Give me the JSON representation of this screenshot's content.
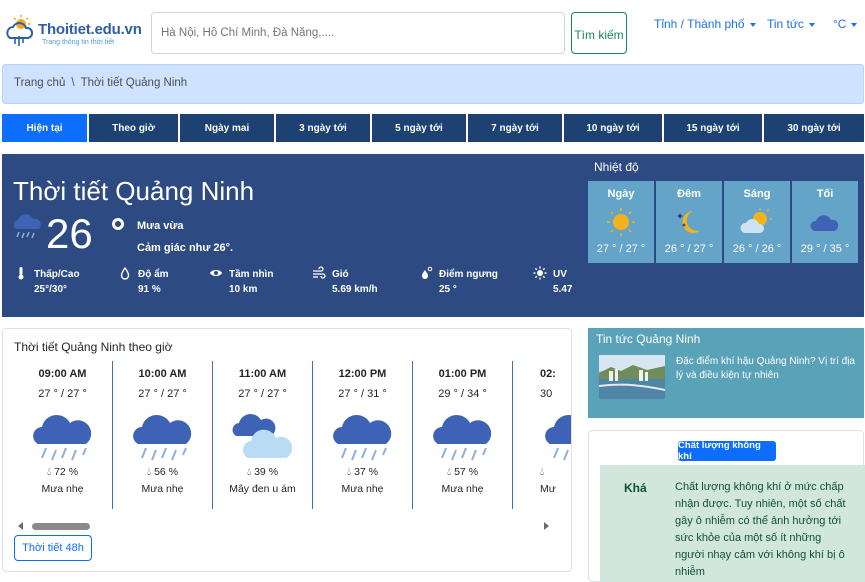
{
  "header": {
    "logo_text": "Thoitiet.edu.vn",
    "logo_sub": "Trang thông tin thời tiết",
    "search_placeholder": "Hà Nội, Hồ Chí Minh, Đà Nẵng,....",
    "search_button": "Tìm kiếm",
    "nav": [
      {
        "label": "Tỉnh / Thành phố"
      },
      {
        "label": "Tin tức"
      },
      {
        "label": "°C"
      }
    ]
  },
  "breadcrumb": {
    "home": "Trang chủ",
    "separator": "\\",
    "current": "Thời tiết Quảng Ninh"
  },
  "tabs": [
    {
      "label": "Hiện tại",
      "active": true
    },
    {
      "label": "Theo giờ"
    },
    {
      "label": "Ngày mai"
    },
    {
      "label": "3 ngày tới"
    },
    {
      "label": "5 ngày tới"
    },
    {
      "label": "7 ngày tới"
    },
    {
      "label": "10 ngày tới"
    },
    {
      "label": "15 ngày tới"
    },
    {
      "label": "30 ngày tới"
    }
  ],
  "current": {
    "title": "Thời tiết Quảng Ninh",
    "temperature": "26",
    "description": "Mưa vừa",
    "feels_like": "Cảm giác như 26°.",
    "icon": "rain-cloud-icon",
    "stats": [
      {
        "label": "Thấp/Cao",
        "value": "25°/30°",
        "icon": "thermometer-icon"
      },
      {
        "label": "Độ ẩm",
        "value": "91 %",
        "icon": "droplet-icon"
      },
      {
        "label": "Tầm nhìn",
        "value": "10 km",
        "icon": "eye-icon"
      },
      {
        "label": "Gió",
        "value": "5.69 km/h",
        "icon": "wind-icon"
      },
      {
        "label": "Điểm ngưng",
        "value": "25 °",
        "icon": "dewpoint-icon"
      },
      {
        "label": "UV",
        "value": "5.47",
        "icon": "sun-uv-icon"
      }
    ]
  },
  "temperature_panel": {
    "title": "Nhiệt độ",
    "cards": [
      {
        "name": "Ngày",
        "temp": "27 ° / 27 °",
        "icon": "sun-icon"
      },
      {
        "name": "Đêm",
        "temp": "26 ° / 27 °",
        "icon": "moon-stars-icon"
      },
      {
        "name": "Sáng",
        "temp": "26 ° / 26 °",
        "icon": "sun-cloud-icon"
      },
      {
        "name": "Tối",
        "temp": "29 ° / 35 °",
        "icon": "cloud-icon"
      }
    ]
  },
  "hourly": {
    "title": "Thời tiết Quảng Ninh theo giờ",
    "items": [
      {
        "time": "09:00 AM",
        "temp": "27 ° / 27 °",
        "humidity": "72 %",
        "desc": "Mưa nhẹ",
        "icon": "rain-cloud-icon"
      },
      {
        "time": "10:00 AM",
        "temp": "27 ° / 27 °",
        "humidity": "56 %",
        "desc": "Mưa nhẹ",
        "icon": "rain-cloud-icon"
      },
      {
        "time": "11:00 AM",
        "temp": "27 ° / 27 °",
        "humidity": "39 %",
        "desc": "Mây đen u ám",
        "icon": "overcast-cloud-icon"
      },
      {
        "time": "12:00 PM",
        "temp": "27 ° / 31 °",
        "humidity": "37 %",
        "desc": "Mưa nhẹ",
        "icon": "rain-cloud-icon"
      },
      {
        "time": "01:00 PM",
        "temp": "29 ° / 34 °",
        "humidity": "57 %",
        "desc": "Mưa nhẹ",
        "icon": "rain-cloud-icon"
      },
      {
        "time": "02:",
        "temp": "30",
        "humidity": "",
        "desc": "Mư",
        "icon": "rain-cloud-icon"
      }
    ],
    "button": "Thời tiết 48h"
  },
  "news": {
    "title": "Tin tức Quảng Ninh",
    "items": [
      {
        "text": "Đặc điểm khí hậu Quảng Ninh? Vị trí địa lý và điều kiện tự nhiên"
      }
    ]
  },
  "air_quality": {
    "badge": "Chất lượng không khí",
    "level": "Khá",
    "text": "Chất lượng không khí ở mức chấp nhận được. Tuy nhiên, một số chất gây ô nhiễm có thể ảnh hưởng tới sức khỏe của một số ít những người nhạy cảm với không khí bị ô nhiễm"
  },
  "colors": {
    "primary": "#0d6efd",
    "tab_bg": "#1e4174",
    "current_bg": "#2d4a82",
    "card_bg": "#64a4c9",
    "news_bg": "#5aa2b8",
    "aq_bg": "#d1e7dd"
  }
}
